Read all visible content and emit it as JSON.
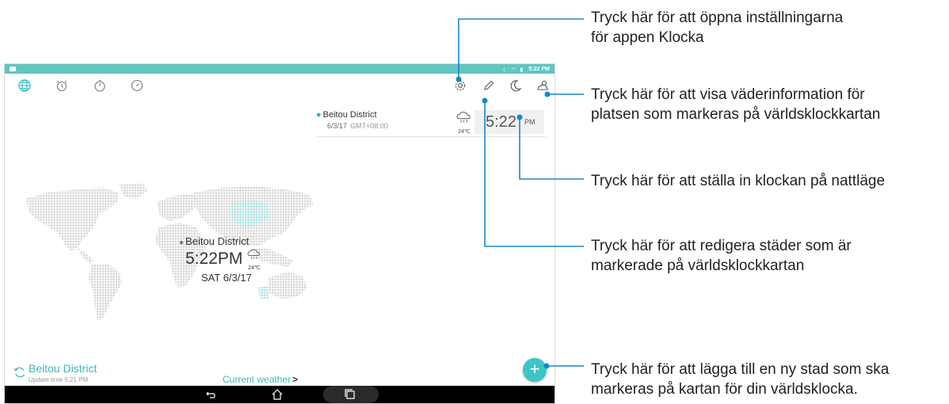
{
  "statusbar": {
    "time": "5:22 PM"
  },
  "card": {
    "city": "Beitou District",
    "date": "6/3/17",
    "gmt": "GMT+08:00",
    "temp": "24℃",
    "time": "5:22",
    "ampm": "PM"
  },
  "map": {
    "city": "Beitou District",
    "time": "5:22PM",
    "temp": "24℃",
    "date": "SAT 6/3/17"
  },
  "bottom": {
    "city": "Beitou District",
    "update": "Update time 5:21 PM",
    "current_weather": "Current weather"
  },
  "fab": {
    "label": "+"
  },
  "callouts": {
    "settings": [
      "Tryck här för att öppna inställningarna",
      "för appen Klocka"
    ],
    "weather": [
      "Tryck här för att visa väderinformation för",
      "platsen som markeras på världsklockkartan"
    ],
    "night": [
      "Tryck här för att ställa in klockan på nattläge"
    ],
    "edit": [
      "Tryck här för att redigera städer som är",
      "markerade på världsklockkartan"
    ],
    "add": [
      "Tryck här för att lägga till en ny stad som ska",
      "markeras på kartan för din världsklocka."
    ]
  },
  "icons": {
    "world_clock": "globe-icon",
    "alarm": "alarm-icon",
    "stopwatch": "stopwatch-icon",
    "timer": "timer-icon",
    "settings": "gear-icon",
    "edit": "pencil-icon",
    "night": "moon-icon",
    "weather": "weather-icon"
  },
  "colors": {
    "accent": "#3cc4c8",
    "statusbar": "#5fc6c2",
    "map_dot": "#d6d6d6",
    "map_highlight": "#a8e2e4"
  }
}
